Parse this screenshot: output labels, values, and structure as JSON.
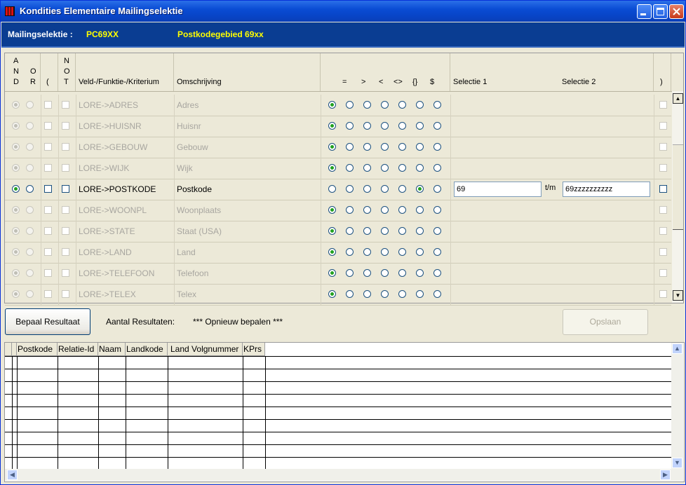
{
  "window": {
    "title": "Kondities Elementaire Mailingselektie"
  },
  "header": {
    "label": "Mailingselektie :",
    "code": "PC69XX",
    "description": "Postkodegebied 69xx"
  },
  "columns": {
    "and_letters": [
      "A",
      "N",
      "D"
    ],
    "or_letters": [
      "O",
      "R"
    ],
    "open_paren": "(",
    "not_letters": [
      "N",
      "O",
      "T"
    ],
    "field": "Veld-/Funktie-/Kriterium",
    "description": "Omschrijving",
    "operators": [
      "=",
      ">",
      "<",
      "<>",
      "{}",
      "$"
    ],
    "selectie1": "Selectie 1",
    "selectie2": "Selectie 2",
    "close_paren": ")"
  },
  "rows": [
    {
      "field": "LORE->ADRES",
      "desc": "Adres",
      "op": 0,
      "active": false
    },
    {
      "field": "LORE->HUISNR",
      "desc": "Huisnr",
      "op": 0,
      "active": false
    },
    {
      "field": "LORE->GEBOUW",
      "desc": "Gebouw",
      "op": 0,
      "active": false
    },
    {
      "field": "LORE->WIJK",
      "desc": "Wijk",
      "op": 0,
      "active": false
    },
    {
      "field": "LORE->POSTKODE",
      "desc": "Postkode",
      "op": 5,
      "active": true,
      "sel1": "69",
      "tm": "t/m",
      "sel2": "69zzzzzzzzzz"
    },
    {
      "field": "LORE->WOONPL",
      "desc": "Woonplaats",
      "op": 0,
      "active": false
    },
    {
      "field": "LORE->STATE",
      "desc": "Staat (USA)",
      "op": 0,
      "active": false
    },
    {
      "field": "LORE->LAND",
      "desc": "Land",
      "op": 0,
      "active": false
    },
    {
      "field": "LORE->TELEFOON",
      "desc": "Telefoon",
      "op": 0,
      "active": false
    },
    {
      "field": "LORE->TELEX",
      "desc": "Telex",
      "op": 0,
      "active": false
    }
  ],
  "actions": {
    "bepaal": "Bepaal Resultaat",
    "aantal_label": "Aantal Resultaten:",
    "aantal_value": "*** Opnieuw bepalen ***",
    "opslaan": "Opslaan"
  },
  "results": {
    "headers": [
      "Postkode",
      "Relatie-Id",
      "Naam",
      "Landkode",
      "Land",
      "Volgnummer",
      "KPrs"
    ]
  },
  "icons": {
    "app": "app-logo-icon",
    "minimize": "minimize-icon",
    "maximize": "maximize-icon",
    "close": "close-icon",
    "scroll_up": "scroll-up-icon",
    "scroll_down": "scroll-down-icon",
    "scroll_left": "scroll-left-icon"
  },
  "colors": {
    "titlebar": "#0A4CD4",
    "header_bg": "#0A3D92",
    "header_label": "#FFFFFF",
    "header_value": "#FFFF00",
    "radio_selected": "#21A121"
  }
}
